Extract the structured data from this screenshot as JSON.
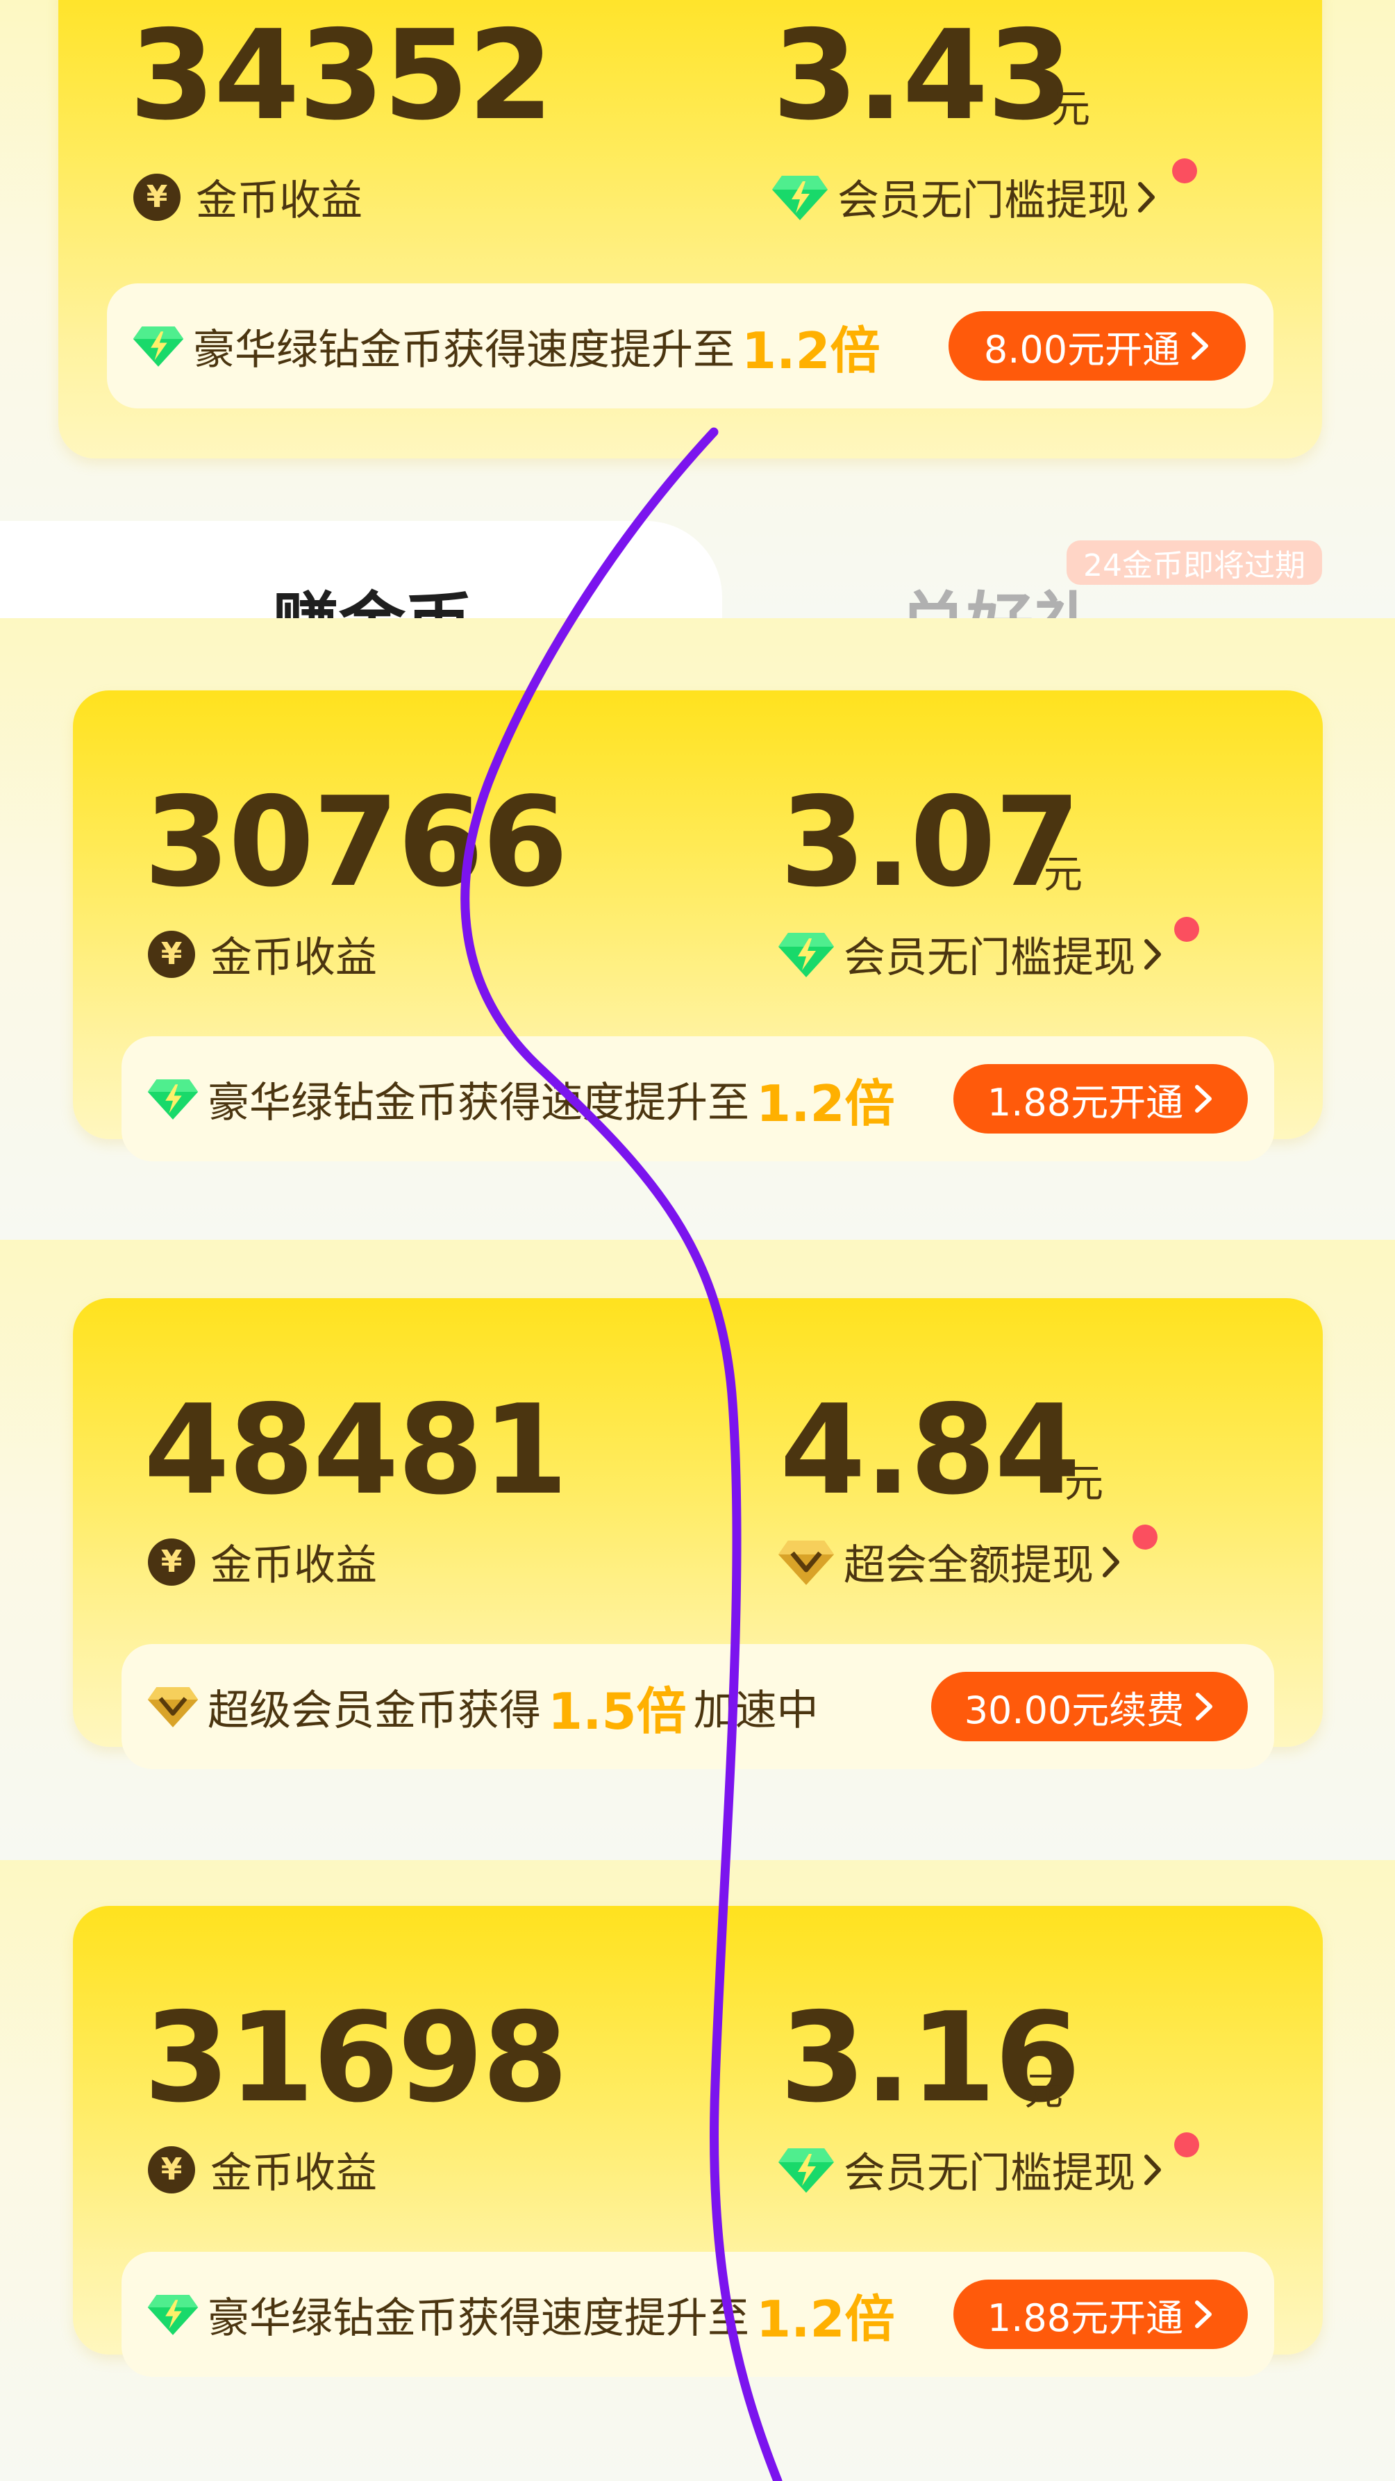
{
  "tabs": {
    "earn": "赚金币",
    "redeem": "兑好礼",
    "expire_badge": "24金币即将过期"
  },
  "cards": [
    {
      "coins": "34352",
      "coins_label": "金币收益",
      "amount": "3.43",
      "unit": "元",
      "withdraw_label": "会员无门槛提现",
      "gem": "green",
      "promo_text": "豪华绿钻金币获得速度提升至",
      "promo_mult": "1.2倍",
      "promo_suffix": "",
      "button": "8.00元开通"
    },
    {
      "coins": "30766",
      "coins_label": "金币收益",
      "amount": "3.07",
      "unit": "元",
      "withdraw_label": "会员无门槛提现",
      "gem": "green",
      "promo_text": "豪华绿钻金币获得速度提升至",
      "promo_mult": "1.2倍",
      "promo_suffix": "",
      "button": "1.88元开通"
    },
    {
      "coins": "48481",
      "coins_label": "金币收益",
      "amount": "4.84",
      "unit": "元",
      "withdraw_label": "超会全额提现",
      "gem": "gold",
      "promo_text": "超级会员金币获得",
      "promo_mult": "1.5倍",
      "promo_suffix": "加速中",
      "button": "30.00元续费"
    },
    {
      "coins": "31698",
      "coins_label": "金币收益",
      "amount": "3.16",
      "unit": "元",
      "withdraw_label": "会员无门槛提现",
      "gem": "green",
      "promo_text": "豪华绿钻金币获得速度提升至",
      "promo_mult": "1.2倍",
      "promo_suffix": "",
      "button": "1.88元开通"
    }
  ],
  "icons": {
    "coin": "yuan-coin-icon",
    "green_gem": "green-diamond-icon",
    "gold_gem": "gold-diamond-icon",
    "chevron": "chevron-right-icon"
  },
  "colors": {
    "accent_orange": "#ff5a0b",
    "multiplier": "#ffb000",
    "text_brown": "#4b3510",
    "stroke_purple": "#7b14ee"
  }
}
